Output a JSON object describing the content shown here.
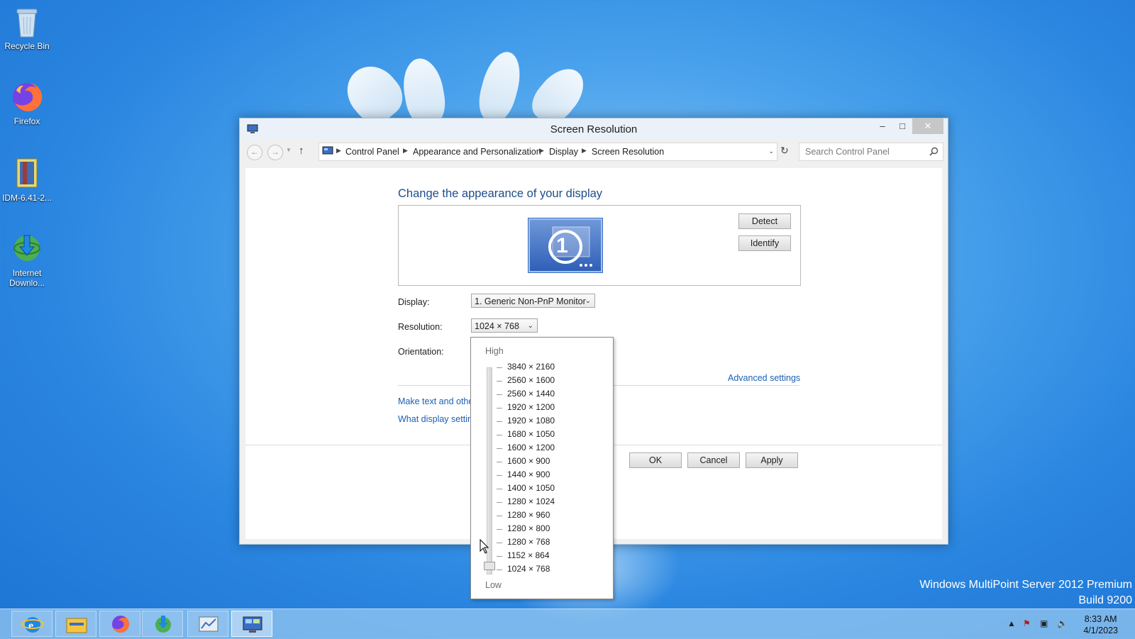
{
  "desktop": {
    "icons": [
      {
        "label": "Recycle Bin",
        "icon": "recycle-bin-icon"
      },
      {
        "label": "Firefox",
        "icon": "firefox-icon"
      },
      {
        "label": "IDM-6.41-2...",
        "icon": "winrar-archive-icon"
      },
      {
        "label": "Internet Downlo...",
        "icon": "internet-download-manager-icon"
      }
    ],
    "watermark_line1": "Windows MultiPoint Server 2012 Premium",
    "watermark_line2": "Build 9200"
  },
  "window": {
    "title": "Screen Resolution",
    "breadcrumbs": [
      "Control Panel",
      "Appearance and Personalization",
      "Display",
      "Screen Resolution"
    ],
    "search_placeholder": "Search Control Panel"
  },
  "main": {
    "heading": "Change the appearance of your display",
    "monitor_number": "1",
    "detect_label": "Detect",
    "identify_label": "Identify",
    "display_label": "Display:",
    "display_value": "1. Generic Non-PnP Monitor",
    "resolution_label": "Resolution:",
    "resolution_value": "1024 × 768",
    "orientation_label": "Orientation:",
    "advanced_link": "Advanced settings",
    "link_text_size": "Make text and other",
    "link_display_settings": "What display setting",
    "ok_label": "OK",
    "cancel_label": "Cancel",
    "apply_label": "Apply"
  },
  "resolution_dropdown": {
    "high_label": "High",
    "low_label": "Low",
    "selected": "1024 × 768",
    "options": [
      "3840 × 2160",
      "2560 × 1600",
      "2560 × 1440",
      "1920 × 1200",
      "1920 × 1080",
      "1680 × 1050",
      "1600 × 1200",
      "1600 × 900",
      "1440 × 900",
      "1400 × 1050",
      "1280 × 1024",
      "1280 × 960",
      "1280 × 800",
      "1280 × 768",
      "1152 × 864",
      "1024 × 768"
    ]
  },
  "taskbar": {
    "items": [
      "internet-explorer-icon",
      "file-explorer-icon",
      "firefox-icon",
      "internet-download-manager-icon",
      "server-manager-icon",
      "control-panel-icon"
    ],
    "time": "8:33 AM",
    "date": "4/1/2023"
  },
  "colors": {
    "accent_link": "#1a5fb4",
    "heading": "#1d4d8c",
    "desktop_blue": "#2a86e0"
  }
}
